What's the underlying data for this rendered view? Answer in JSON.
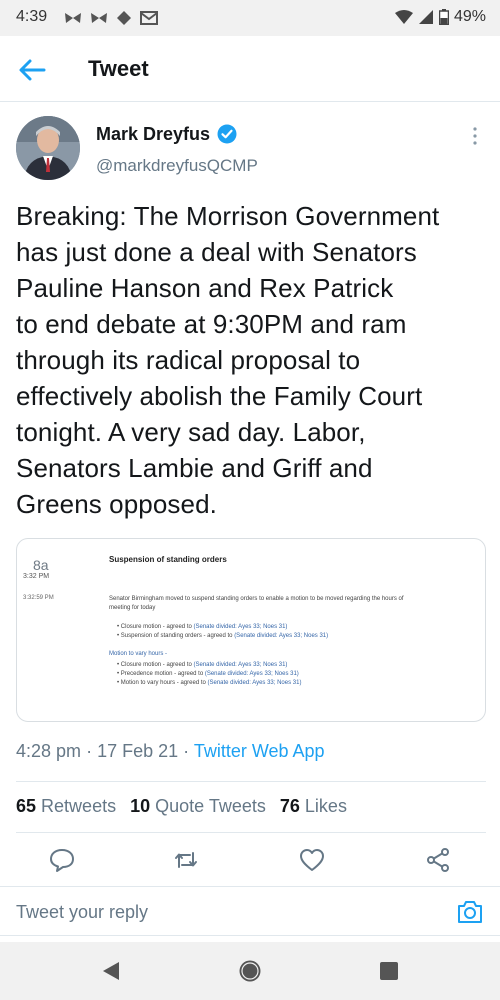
{
  "status_bar": {
    "time": "4:39",
    "battery": "49%",
    "left_icons": [
      "butterfly-icon",
      "butterfly-icon",
      "diamond-icon",
      "mail-icon"
    ],
    "right_icons": [
      "wifi-icon",
      "signal-icon",
      "battery-icon"
    ]
  },
  "app_bar": {
    "title": "Tweet",
    "back_icon": "arrow-left-icon"
  },
  "author": {
    "name": "Mark Dreyfus",
    "handle": "@markdreyfusQCMP"
  },
  "tweet": {
    "lines": [
      "Breaking: The Morrison Government",
      "has just done a deal with Senators",
      "Pauline Hanson and Rex Patrick",
      "to end debate at 9:30PM and ram",
      "through its radical proposal to",
      "effectively abolish the Family Court",
      "tonight. A very sad day. Labor,",
      "Senators Lambie and Griff and",
      "Greens opposed."
    ],
    "time": "4:28 pm",
    "date": "17 Feb 21",
    "source": "Twitter Web App"
  },
  "media": {
    "hour_num": "8a",
    "hour_time": "3:32 PM",
    "row_time": "3:32:59 PM",
    "heading": "Suspension of standing orders",
    "para": "Senator Birmingham moved to suspend standing orders to enable a motion to be moved regarding the hours of meeting for today",
    "items1": [
      {
        "text": "Closure motion - agreed to ",
        "link": "(Senate divided: Ayes 33; Noes 31)"
      },
      {
        "text": "Suspension of standing orders - agreed to ",
        "link": "(Senate divided: Ayes 33; Noes 31)"
      }
    ],
    "subhead": "Motion to vary hours -",
    "items2": [
      {
        "text": "Closure motion - agreed to ",
        "link": "(Senate divided: Ayes 33; Noes 31)"
      },
      {
        "text": "Precedence motion - agreed to ",
        "link": "(Senate divided: Ayes 33; Noes 31)"
      },
      {
        "text": "Motion to vary hours - agreed to ",
        "link": "(Senate divided: Ayes 33; Noes 31)"
      }
    ]
  },
  "stats": {
    "retweets_count": "65",
    "retweets_label": "Retweets",
    "quotes_count": "10",
    "quotes_label": "Quote Tweets",
    "likes_count": "76",
    "likes_label": "Likes"
  },
  "actions": [
    "reply-icon",
    "retweet-icon",
    "like-icon",
    "share-icon"
  ],
  "reply": {
    "placeholder": "Tweet your reply"
  },
  "colors": {
    "accent": "#1da1f2",
    "text": "#14171a",
    "muted": "#657786"
  }
}
